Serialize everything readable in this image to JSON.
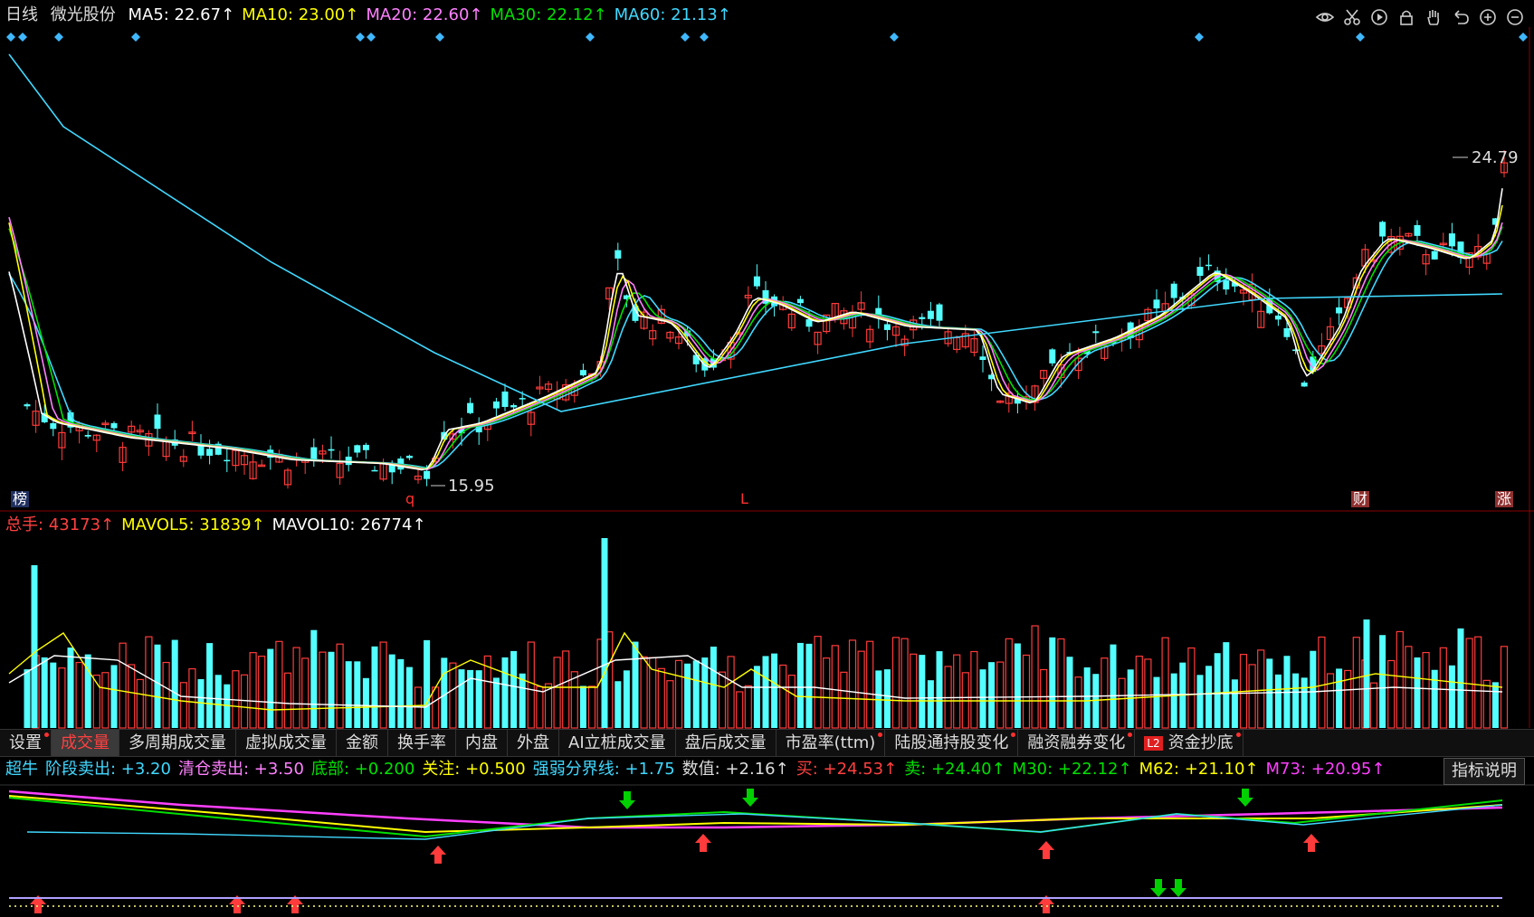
{
  "header": {
    "period": "日线",
    "stock_name": "微光股份",
    "ma": [
      {
        "label": "MA5: 22.67↑",
        "color": "#ffffff"
      },
      {
        "label": "MA10: 23.00↑",
        "color": "#ffff00"
      },
      {
        "label": "MA20: 22.60↑",
        "color": "#ff80ff"
      },
      {
        "label": "MA30: 22.12↑",
        "color": "#00e000"
      },
      {
        "label": "MA60: 21.13↑",
        "color": "#40d8ff"
      }
    ]
  },
  "toolbar_icons": [
    "eye-icon",
    "scissors-icon",
    "play-icon",
    "lock-icon",
    "hand-icon",
    "undo-icon",
    "zoom-in-icon",
    "zoom-out-icon"
  ],
  "price_chart": {
    "high_label": "24.79",
    "low_label": "15.95",
    "bottom_markers": [
      {
        "text": "榜",
        "color": "#ffffff",
        "bg": "#203060"
      },
      {
        "text": "q",
        "color": "#ff3030"
      },
      {
        "text": "L",
        "color": "#ff3030"
      },
      {
        "text": "财",
        "color": "#ffffff",
        "bg": "#903030"
      },
      {
        "text": "涨",
        "color": "#ffffff",
        "bg": "#903030"
      }
    ]
  },
  "volume_header": [
    {
      "label": "总手: 43173↑",
      "color": "#ff4040"
    },
    {
      "label": "MAVOL5: 31839↑",
      "color": "#ffff00"
    },
    {
      "label": "MAVOL10: 26774↑",
      "color": "#ffffff"
    }
  ],
  "tabs": [
    {
      "label": "设置",
      "dot": true
    },
    {
      "label": "成交量",
      "active": true
    },
    {
      "label": "多周期成交量"
    },
    {
      "label": "虚拟成交量"
    },
    {
      "label": "金额"
    },
    {
      "label": "换手率"
    },
    {
      "label": "内盘"
    },
    {
      "label": "外盘"
    },
    {
      "label": "AI立桩成交量"
    },
    {
      "label": "盘后成交量"
    },
    {
      "label": "市盈率(ttm)",
      "dot": true
    },
    {
      "label": "陆股通持股变化",
      "dot": true
    },
    {
      "label": "融资融券变化",
      "dot": true
    },
    {
      "label": "资金抄底",
      "dot": true,
      "l2": "L2"
    }
  ],
  "indicator_header": [
    {
      "label": "超牛",
      "color": "#40d8ff"
    },
    {
      "label": "阶段卖出: +3.20",
      "color": "#40d8ff"
    },
    {
      "label": "清仓卖出: +3.50",
      "color": "#ff80ff"
    },
    {
      "label": "底部: +0.200",
      "color": "#00e000"
    },
    {
      "label": "关注: +0.500",
      "color": "#ffff00"
    },
    {
      "label": "强弱分界线: +1.75",
      "color": "#40d8ff"
    },
    {
      "label": "数值: +2.16↑",
      "color": "#dddddd"
    },
    {
      "label": "买: +24.53↑",
      "color": "#ff4040"
    },
    {
      "label": "卖: +24.40↑",
      "color": "#00e000"
    },
    {
      "label": "M30: +22.12↑",
      "color": "#00e000"
    },
    {
      "label": "M62: +21.10↑",
      "color": "#ffff00"
    },
    {
      "label": "M73: +20.95↑",
      "color": "#ff40ff"
    }
  ],
  "explain_button": "指标说明",
  "colors": {
    "up": "#ff3b3b",
    "down": "#54ffff",
    "ma5": "#ffffff",
    "ma10": "#ffff00",
    "ma20": "#ff80ff",
    "ma30": "#00e000",
    "ma60": "#40d8ff"
  }
}
